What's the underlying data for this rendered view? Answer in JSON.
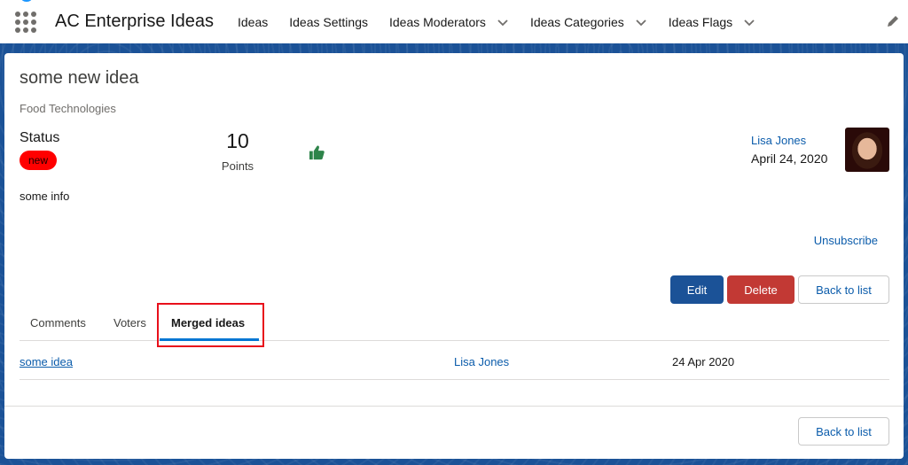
{
  "app": {
    "name": "AC Enterprise Ideas"
  },
  "nav": {
    "items": [
      {
        "label": "Ideas"
      },
      {
        "label": "Ideas Settings"
      },
      {
        "label": "Ideas Moderators"
      },
      {
        "label": "Ideas Categories"
      },
      {
        "label": "Ideas Flags"
      }
    ]
  },
  "idea": {
    "title": "some new idea",
    "category": "Food Technologies",
    "status_label": "Status",
    "status_value": "new",
    "points": "10",
    "points_label": "Points",
    "author": "Lisa Jones",
    "date": "April 24, 2020",
    "info": "some info"
  },
  "actions": {
    "unsubscribe": "Unsubscribe",
    "edit": "Edit",
    "delete": "Delete",
    "back_to_list": "Back to list"
  },
  "tabs": [
    {
      "label": "Comments"
    },
    {
      "label": "Voters"
    },
    {
      "label": "Merged ideas",
      "active": true
    }
  ],
  "merged_ideas": [
    {
      "idea": "some idea",
      "author": "Lisa Jones",
      "date": "24 Apr 2020"
    }
  ],
  "colors": {
    "brand_blue": "#1b5297",
    "status_new": "#ff0000",
    "delete_red": "#c23934",
    "link_blue": "#0b5cab",
    "highlight_red": "#e8101b",
    "upvote_green": "#2e844a"
  },
  "icons": {
    "app_launcher": "waffle-icon",
    "chevron": "chevron-down-icon",
    "edit_nav": "pencil-icon",
    "upvote": "thumbs-up-icon"
  }
}
